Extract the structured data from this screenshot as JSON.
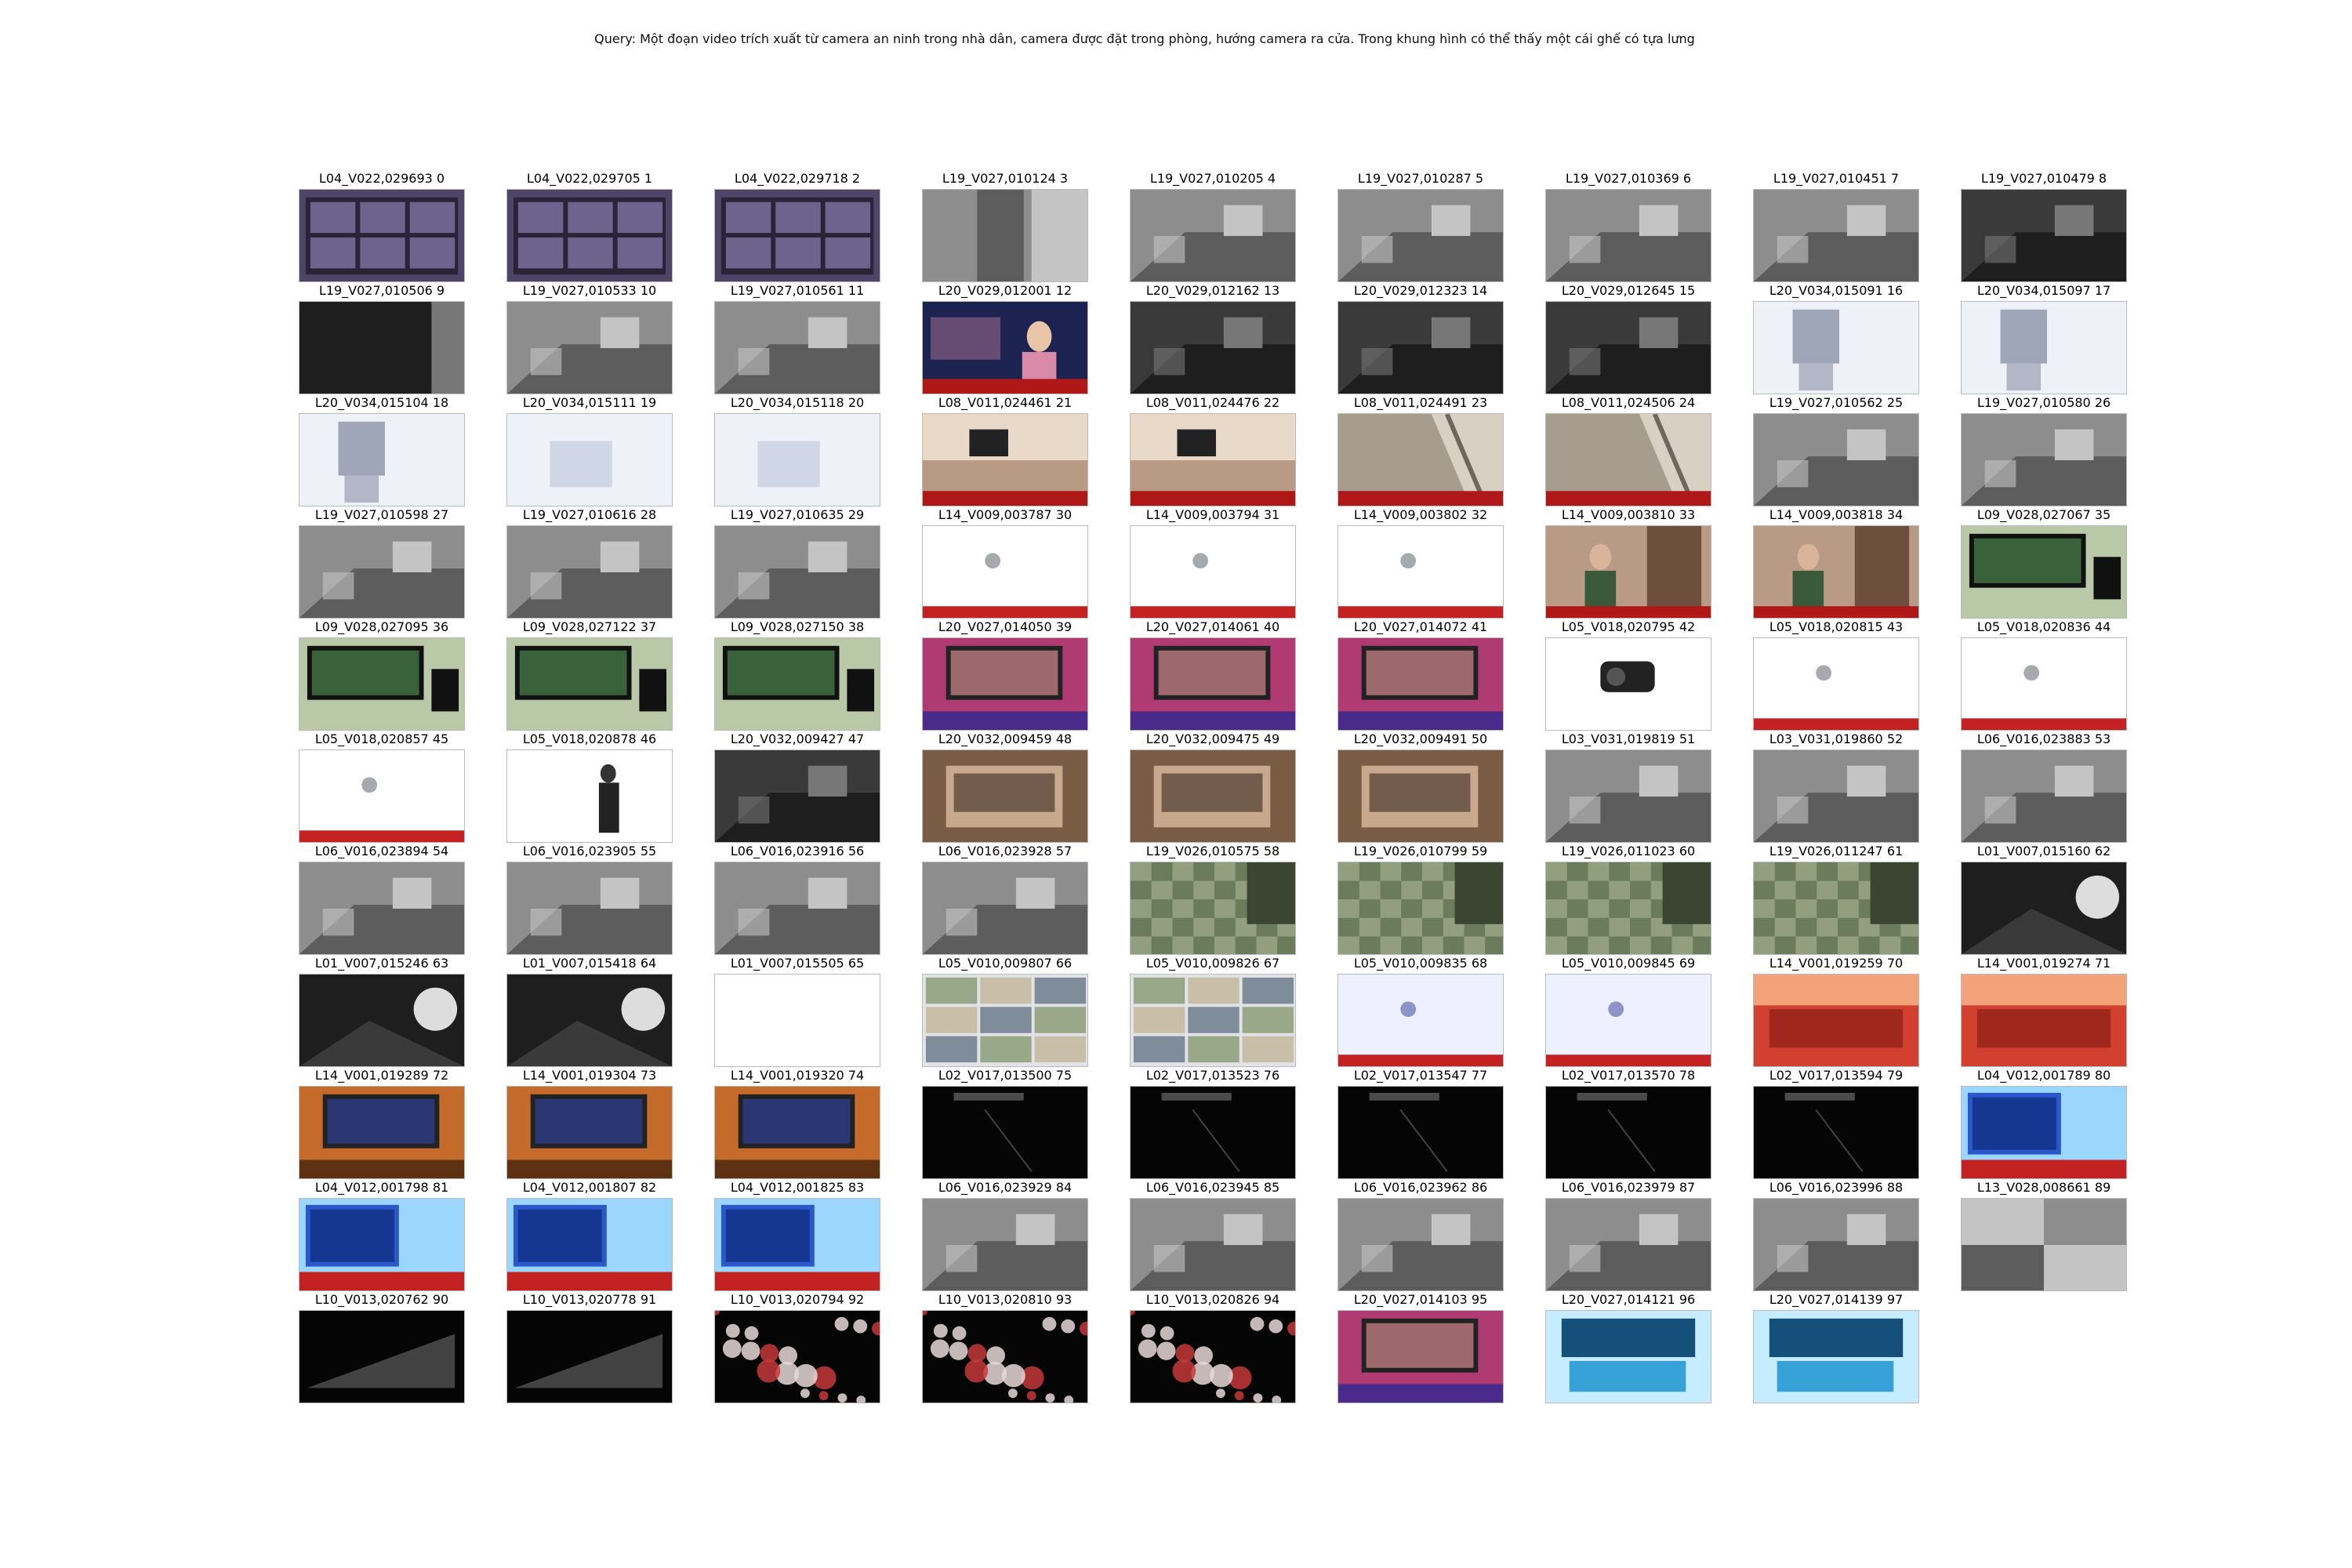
{
  "query": "Query: Một đoạn video trích xuất từ camera an ninh trong nhà dân, camera được đặt trong phòng, hướng camera ra cửa. Trong khung hình có thể thấy một cái ghế có tựa lưng",
  "results": [
    {
      "label": "L04_V022,029693 0",
      "scene": "wall-monitors",
      "tone": "purple"
    },
    {
      "label": "L04_V022,029705 1",
      "scene": "wall-monitors",
      "tone": "purple"
    },
    {
      "label": "L04_V022,029718 2",
      "scene": "wall-monitors",
      "tone": "purple"
    },
    {
      "label": "L19_V027,010124 3",
      "scene": "cctv-doorway",
      "tone": "gray"
    },
    {
      "label": "L19_V027,010205 4",
      "scene": "cctv-room",
      "tone": "gray"
    },
    {
      "label": "L19_V027,010287 5",
      "scene": "cctv-room",
      "tone": "gray"
    },
    {
      "label": "L19_V027,010369 6",
      "scene": "cctv-room",
      "tone": "gray"
    },
    {
      "label": "L19_V027,010451 7",
      "scene": "cctv-room",
      "tone": "gray"
    },
    {
      "label": "L19_V027,010479 8",
      "scene": "cctv-room",
      "tone": "dark"
    },
    {
      "label": "L19_V027,010506 9",
      "scene": "cctv-dark",
      "tone": "dark"
    },
    {
      "label": "L19_V027,010533 10",
      "scene": "cctv-room",
      "tone": "gray"
    },
    {
      "label": "L19_V027,010561 11",
      "scene": "cctv-room",
      "tone": "gray"
    },
    {
      "label": "L20_V029,012001 12",
      "scene": "news-anchor",
      "tone": "navy"
    },
    {
      "label": "L20_V029,012162 13",
      "scene": "cctv-room",
      "tone": "dark"
    },
    {
      "label": "L20_V029,012323 14",
      "scene": "cctv-room",
      "tone": "dark"
    },
    {
      "label": "L20_V029,012645 15",
      "scene": "cctv-room",
      "tone": "dark"
    },
    {
      "label": "L20_V034,015091 16",
      "scene": "chair-room",
      "tone": "light"
    },
    {
      "label": "L20_V034,015097 17",
      "scene": "chair-room",
      "tone": "light"
    },
    {
      "label": "L20_V034,015104 18",
      "scene": "chair-room",
      "tone": "light"
    },
    {
      "label": "L20_V034,015111 19",
      "scene": "blurred",
      "tone": "light"
    },
    {
      "label": "L20_V034,015118 20",
      "scene": "blurred",
      "tone": "light"
    },
    {
      "label": "L08_V011,024461 21",
      "scene": "living-room",
      "tone": "warm"
    },
    {
      "label": "L08_V011,024476 22",
      "scene": "living-room",
      "tone": "warm"
    },
    {
      "label": "L08_V011,024491 23",
      "scene": "wall-corner",
      "tone": "beige"
    },
    {
      "label": "L08_V011,024506 24",
      "scene": "wall-corner",
      "tone": "beige"
    },
    {
      "label": "L19_V027,010562 25",
      "scene": "cctv-room",
      "tone": "gray"
    },
    {
      "label": "L19_V027,010580 26",
      "scene": "cctv-room",
      "tone": "gray"
    },
    {
      "label": "L19_V027,010598 27",
      "scene": "cctv-room",
      "tone": "gray"
    },
    {
      "label": "L19_V027,010616 28",
      "scene": "cctv-room",
      "tone": "gray"
    },
    {
      "label": "L19_V027,010635 29",
      "scene": "cctv-room",
      "tone": "gray"
    },
    {
      "label": "L14_V009,003787 30",
      "scene": "camera-wall",
      "tone": "pale"
    },
    {
      "label": "L14_V009,003794 31",
      "scene": "camera-wall",
      "tone": "pale"
    },
    {
      "label": "L14_V009,003802 32",
      "scene": "camera-wall",
      "tone": "pale"
    },
    {
      "label": "L14_V009,003810 33",
      "scene": "people-door",
      "tone": "warm"
    },
    {
      "label": "L14_V009,003818 34",
      "scene": "people-door",
      "tone": "warm"
    },
    {
      "label": "L09_V028,027067 35",
      "scene": "monitor-desk",
      "tone": "green"
    },
    {
      "label": "L09_V028,027095 36",
      "scene": "monitor-desk",
      "tone": "green"
    },
    {
      "label": "L09_V028,027122 37",
      "scene": "monitor-desk",
      "tone": "green"
    },
    {
      "label": "L09_V028,027150 38",
      "scene": "monitor-desk",
      "tone": "green"
    },
    {
      "label": "L20_V027,014050 39",
      "scene": "tv-room",
      "tone": "colorful"
    },
    {
      "label": "L20_V027,014061 40",
      "scene": "tv-room",
      "tone": "colorful"
    },
    {
      "label": "L20_V027,014072 41",
      "scene": "tv-room",
      "tone": "colorful"
    },
    {
      "label": "L05_V018,020795 42",
      "scene": "camera-closeup",
      "tone": "pale"
    },
    {
      "label": "L05_V018,020815 43",
      "scene": "camera-wall",
      "tone": "pale"
    },
    {
      "label": "L05_V018,020836 44",
      "scene": "camera-wall",
      "tone": "pale"
    },
    {
      "label": "L05_V018,020857 45",
      "scene": "camera-wall",
      "tone": "pale"
    },
    {
      "label": "L05_V018,020878 46",
      "scene": "person-hall",
      "tone": "pale"
    },
    {
      "label": "L20_V032,009427 47",
      "scene": "cctv-room",
      "tone": "dark"
    },
    {
      "label": "L20_V032,009459 48",
      "scene": "bedroom",
      "tone": "brown"
    },
    {
      "label": "L20_V032,009475 49",
      "scene": "bedroom",
      "tone": "brown"
    },
    {
      "label": "L20_V032,009491 50",
      "scene": "bedroom",
      "tone": "brown"
    },
    {
      "label": "L03_V031,019819 51",
      "scene": "cctv-room",
      "tone": "gray"
    },
    {
      "label": "L03_V031,019860 52",
      "scene": "cctv-room",
      "tone": "gray"
    },
    {
      "label": "L06_V016,023883 53",
      "scene": "cctv-room",
      "tone": "gray"
    },
    {
      "label": "L06_V016,023894 54",
      "scene": "cctv-room",
      "tone": "gray"
    },
    {
      "label": "L06_V016,023905 55",
      "scene": "cctv-room",
      "tone": "gray"
    },
    {
      "label": "L06_V016,023916 56",
      "scene": "cctv-room",
      "tone": "gray"
    },
    {
      "label": "L06_V016,023928 57",
      "scene": "cctv-room",
      "tone": "gray"
    },
    {
      "label": "L19_V026,010575 58",
      "scene": "tile-floor",
      "tone": "greenish"
    },
    {
      "label": "L19_V026,010799 59",
      "scene": "tile-floor",
      "tone": "greenish"
    },
    {
      "label": "L19_V026,011023 60",
      "scene": "tile-floor",
      "tone": "greenish"
    },
    {
      "label": "L19_V026,011247 61",
      "scene": "tile-floor",
      "tone": "greenish"
    },
    {
      "label": "L01_V007,015160 62",
      "scene": "night-light",
      "tone": "dark"
    },
    {
      "label": "L01_V007,015246 63",
      "scene": "night-light",
      "tone": "dark"
    },
    {
      "label": "L01_V007,015418 64",
      "scene": "night-light",
      "tone": "dark"
    },
    {
      "label": "L01_V007,015505 65",
      "scene": "washed",
      "tone": "pale"
    },
    {
      "label": "L05_V010,009807 66",
      "scene": "multi-view",
      "tone": "pale"
    },
    {
      "label": "L05_V010,009826 67",
      "scene": "multi-view",
      "tone": "pale"
    },
    {
      "label": "L05_V010,009835 68",
      "scene": "camera-wall",
      "tone": "lavender"
    },
    {
      "label": "L05_V010,009845 69",
      "scene": "camera-wall",
      "tone": "lavender"
    },
    {
      "label": "L14_V001,019259 70",
      "scene": "red-hall",
      "tone": "red"
    },
    {
      "label": "L14_V001,019274 71",
      "scene": "red-hall",
      "tone": "red"
    },
    {
      "label": "L14_V001,019289 72",
      "scene": "tv-room",
      "tone": "orange"
    },
    {
      "label": "L14_V001,019304 73",
      "scene": "tv-room",
      "tone": "orange"
    },
    {
      "label": "L14_V001,019320 74",
      "scene": "tv-room",
      "tone": "orange"
    },
    {
      "label": "L02_V017,013500 75",
      "scene": "dark-night",
      "tone": "black"
    },
    {
      "label": "L02_V017,013523 76",
      "scene": "dark-night",
      "tone": "black"
    },
    {
      "label": "L02_V017,013547 77",
      "scene": "dark-night",
      "tone": "black"
    },
    {
      "label": "L02_V017,013570 78",
      "scene": "dark-night",
      "tone": "black"
    },
    {
      "label": "L02_V017,013594 79",
      "scene": "dark-night",
      "tone": "black"
    },
    {
      "label": "L04_V012,001789 80",
      "scene": "blue-screen",
      "tone": "blue"
    },
    {
      "label": "L04_V012,001798 81",
      "scene": "blue-screen",
      "tone": "blue"
    },
    {
      "label": "L04_V012,001807 82",
      "scene": "blue-screen",
      "tone": "blue"
    },
    {
      "label": "L04_V012,001825 83",
      "scene": "blue-screen",
      "tone": "blue"
    },
    {
      "label": "L06_V016,023929 84",
      "scene": "cctv-room",
      "tone": "gray"
    },
    {
      "label": "L06_V016,023945 85",
      "scene": "cctv-room",
      "tone": "gray"
    },
    {
      "label": "L06_V016,023962 86",
      "scene": "cctv-room",
      "tone": "gray"
    },
    {
      "label": "L06_V016,023979 87",
      "scene": "cctv-room",
      "tone": "gray"
    },
    {
      "label": "L06_V016,023996 88",
      "scene": "cctv-room",
      "tone": "gray"
    },
    {
      "label": "L13_V028,008661 89",
      "scene": "split-cctv",
      "tone": "gray"
    },
    {
      "label": "L10_V013,020762 90",
      "scene": "dark-screens",
      "tone": "black"
    },
    {
      "label": "L10_V013,020778 91",
      "scene": "dark-screens",
      "tone": "black"
    },
    {
      "label": "L10_V013,020794 92",
      "scene": "scatter",
      "tone": "black"
    },
    {
      "label": "L10_V013,020810 93",
      "scene": "scatter",
      "tone": "black"
    },
    {
      "label": "L10_V013,020826 94",
      "scene": "scatter",
      "tone": "black"
    },
    {
      "label": "L20_V027,014103 95",
      "scene": "tv-room",
      "tone": "colorful"
    },
    {
      "label": "L20_V027,014121 96",
      "scene": "control-room",
      "tone": "cyan"
    },
    {
      "label": "L20_V027,014139 97",
      "scene": "control-room",
      "tone": "cyan"
    }
  ]
}
